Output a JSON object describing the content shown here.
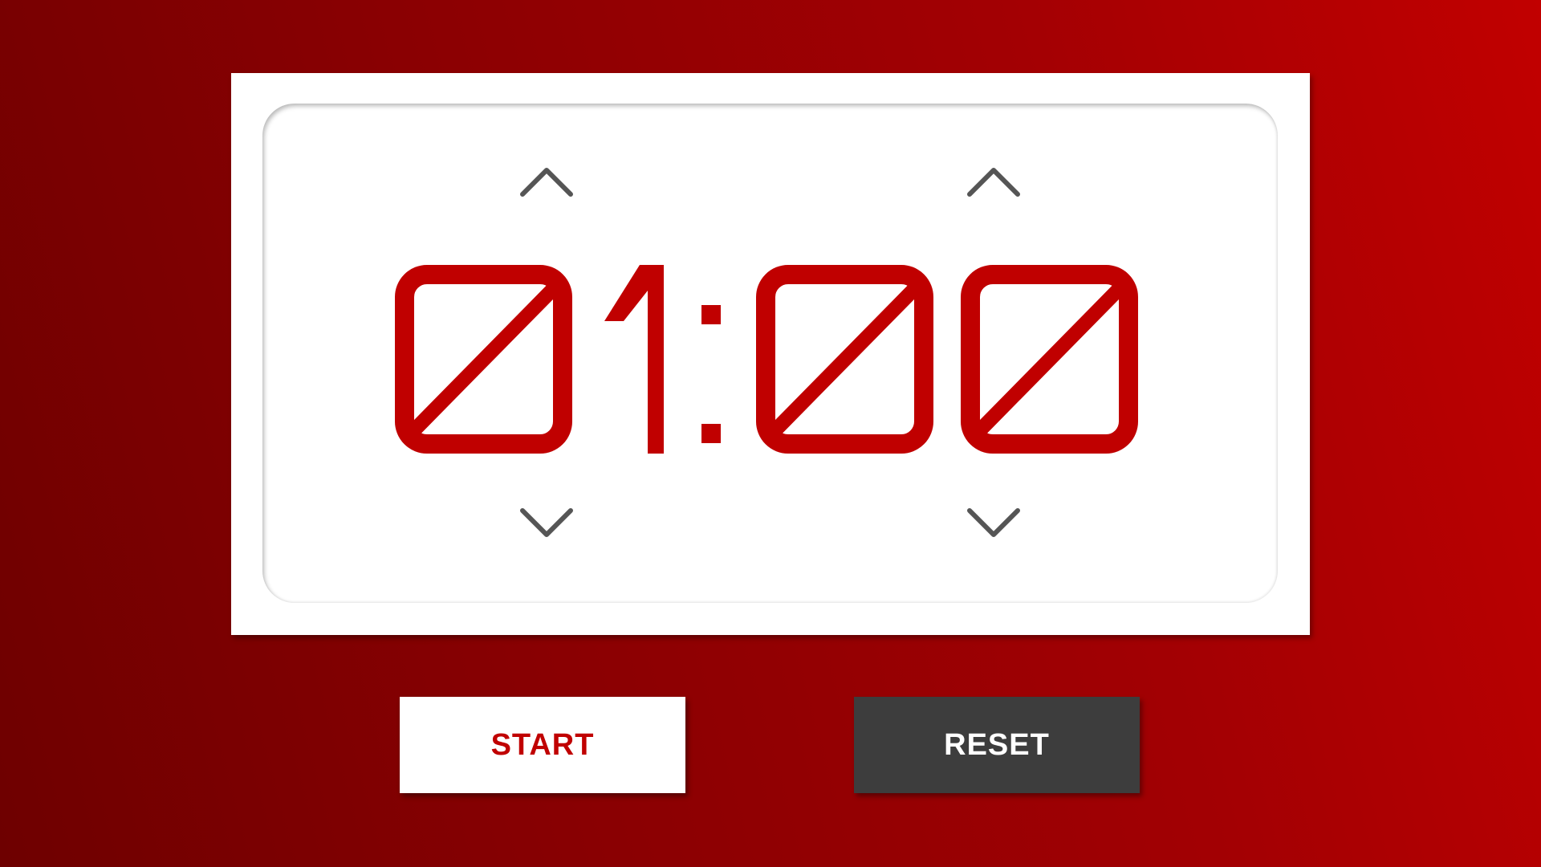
{
  "timer": {
    "digits": [
      "0",
      "1",
      "0",
      "0"
    ],
    "separator": ":",
    "display_text": "01:00",
    "digit_color": "#c00000",
    "arrow_color": "#555555",
    "minutes_up_icon": "chevron-up-icon",
    "minutes_down_icon": "chevron-down-icon",
    "seconds_up_icon": "chevron-up-icon",
    "seconds_down_icon": "chevron-down-icon"
  },
  "controls": {
    "start_label": "START",
    "reset_label": "RESET",
    "start_text_color": "#c00000",
    "reset_bg_color": "#3d3d3d"
  },
  "background": {
    "gradient_from": "#6e0000",
    "gradient_to": "#c10000"
  }
}
